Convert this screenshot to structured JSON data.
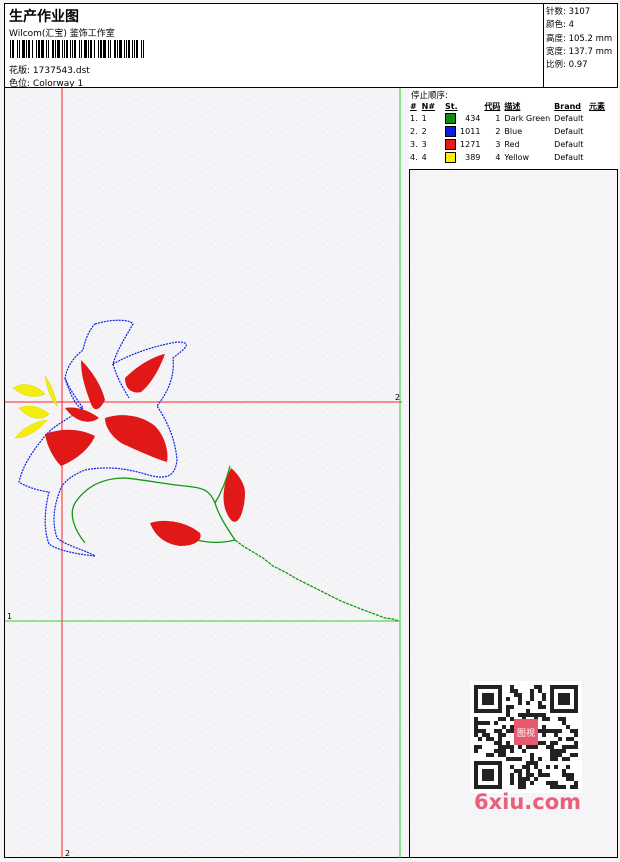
{
  "header": {
    "title": "生产作业图",
    "subtitle": "Wilcom(汇宝) 鉴饰工作室",
    "design_label": "花版:",
    "design_value": "1737543.dst",
    "colorway_label": "色位:",
    "colorway_value": "Colorway 1"
  },
  "stats": [
    {
      "label": "针数:",
      "value": "3107"
    },
    {
      "label": "颜色:",
      "value": "4"
    },
    {
      "label": "高度:",
      "value": "105.2 mm"
    },
    {
      "label": "宽度:",
      "value": "137.7 mm"
    },
    {
      "label": "比例:",
      "value": "0.97"
    }
  ],
  "stop_sequence": {
    "title": "停止顺序:",
    "headers": [
      "#",
      "N#",
      "St.",
      "代码",
      "描述",
      "Brand",
      "元素"
    ],
    "rows": [
      {
        "idx": "1.",
        "n": "1",
        "color": "#118a11",
        "st": "434",
        "code": "1",
        "desc": "Dark Green",
        "brand": "Default"
      },
      {
        "idx": "2.",
        "n": "2",
        "color": "#0b1de0",
        "st": "1011",
        "code": "2",
        "desc": "Blue",
        "brand": "Default"
      },
      {
        "idx": "3.",
        "n": "3",
        "color": "#e41b1b",
        "st": "1271",
        "code": "3",
        "desc": "Red",
        "brand": "Default"
      },
      {
        "idx": "4.",
        "n": "4",
        "color": "#ffef00",
        "st": "389",
        "code": "4",
        "desc": "Yellow",
        "brand": "Default"
      }
    ]
  },
  "canvas_markers": {
    "top_right": "2",
    "bottom": "2",
    "left": "1"
  },
  "watermark": {
    "logo": "6xiu.com",
    "stamp": "图视"
  },
  "colors": {
    "guide_red": "#ff2020",
    "guide_green": "#30d030",
    "stem": "#119911",
    "outline": "#0a1ee8",
    "fill": "#e01818",
    "yellow": "#f4ee10"
  }
}
